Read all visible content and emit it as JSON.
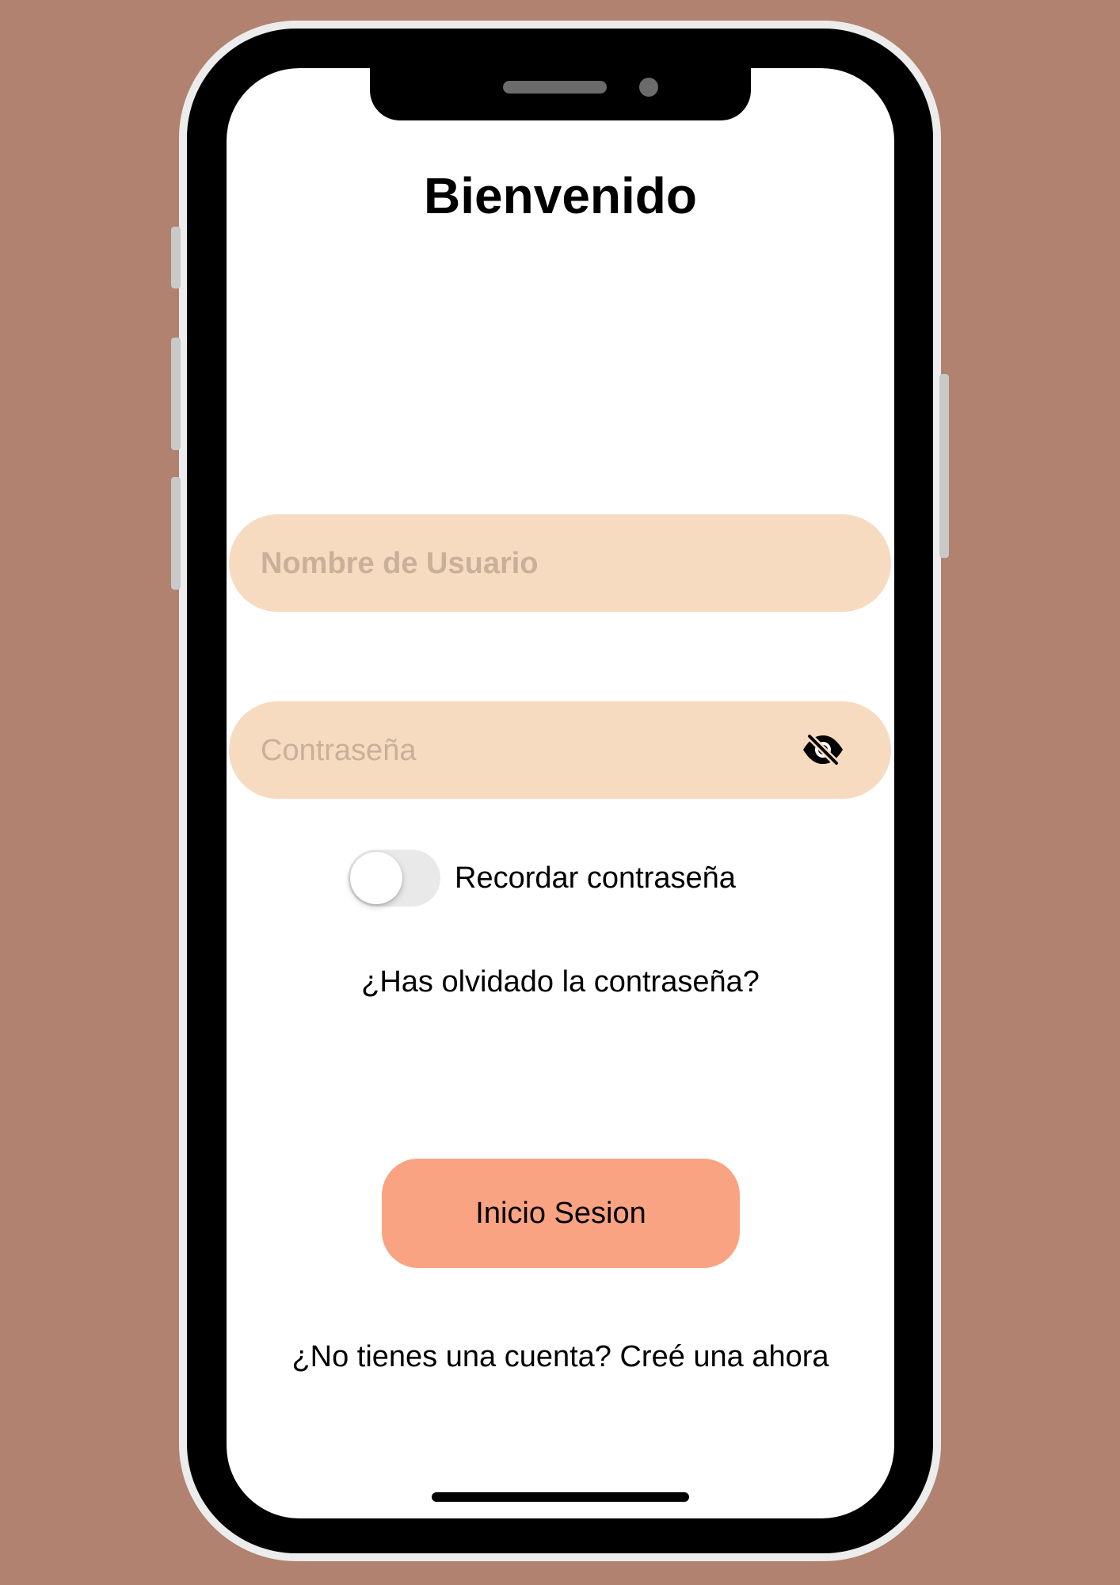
{
  "screen": {
    "title": "Bienvenido",
    "username": {
      "value": "",
      "placeholder": "Nombre de Usuario"
    },
    "password": {
      "value": "",
      "placeholder": "Contraseña",
      "visibility_icon": "eye-slash-icon"
    },
    "remember": {
      "label": "Recordar contraseña",
      "enabled": false
    },
    "forgot_link": "¿Has olvidado la contraseña?",
    "login_button": "Inicio Sesion",
    "signup_link": "¿No tienes una cuenta? Creé una ahora"
  },
  "colors": {
    "background": "#b0826f",
    "field": "#f7dbc0",
    "field_placeholder": "#c9b09a",
    "button": "#f9a382",
    "toggle_off": "#e9e9ea"
  }
}
